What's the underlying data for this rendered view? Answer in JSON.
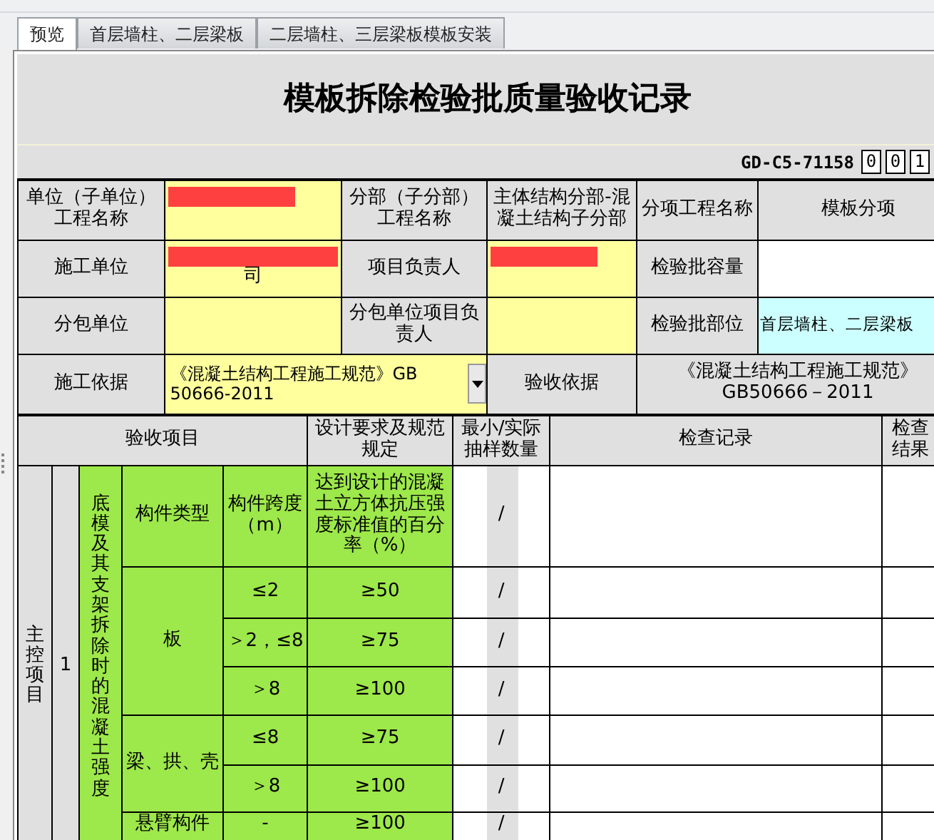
{
  "tabs": [
    {
      "label": "预览",
      "selected": true
    },
    {
      "label": "首层墙柱、二层梁板",
      "selected": false
    },
    {
      "label": "二层墙柱、三层梁板模板安装",
      "selected": false
    }
  ],
  "title": "模板拆除检验批质量验收记录",
  "form_code": "GD-C5-71158",
  "serial_digits": [
    "0",
    "0",
    "1"
  ],
  "info_rows": [
    [
      {
        "kind": "label",
        "text": "单位（子单位）工程名称"
      },
      {
        "kind": "input",
        "redacted": true
      },
      {
        "kind": "label",
        "text": "分部（子分部）工程名称"
      },
      {
        "kind": "label",
        "text": "主体结构分部-混凝土结构子分部"
      },
      {
        "kind": "label",
        "text": "分项工程名称"
      },
      {
        "kind": "label",
        "text": "模板分项"
      }
    ],
    [
      {
        "kind": "label",
        "text": "施工单位"
      },
      {
        "kind": "input",
        "redacted": true,
        "text": "司"
      },
      {
        "kind": "label",
        "text": "项目负责人"
      },
      {
        "kind": "input",
        "redacted": true
      },
      {
        "kind": "label",
        "text": "检验批容量"
      },
      {
        "kind": "field"
      }
    ],
    [
      {
        "kind": "label",
        "text": "分包单位"
      },
      {
        "kind": "input"
      },
      {
        "kind": "label",
        "text": "分包单位项目负责人"
      },
      {
        "kind": "input"
      },
      {
        "kind": "label",
        "text": "检验批部位"
      },
      {
        "kind": "highlight",
        "text": "首层墙柱、二层梁板"
      }
    ],
    [
      {
        "kind": "label",
        "text": "施工依据"
      },
      {
        "kind": "dropdown",
        "text": "《混凝土结构工程施工规范》GB 50666-2011"
      },
      {
        "kind": "label",
        "text": "验收依据"
      },
      {
        "kind": "label",
        "text": "《混凝土结构工程施工规范》GB50666－2011"
      }
    ]
  ],
  "checklist": {
    "headers": [
      "验收项目",
      "设计要求及规范规定",
      "最小/实际抽样数量",
      "检查记录",
      "检查结果"
    ],
    "category": "主控项目",
    "item_no": "1",
    "item_name": "底模及其支架拆除时的混凝土强度",
    "column_titles": [
      "构件类型",
      "构件跨度（m）",
      "达到设计的混凝土立方体抗压强度标准值的百分率（%）",
      "/"
    ],
    "groups": [
      {
        "type": "板",
        "rows": [
          {
            "span": "≤2",
            "requirement": "≥50",
            "sampling": "/"
          },
          {
            "span": "＞2，≤8",
            "requirement": "≥75",
            "sampling": "/"
          },
          {
            "span": "＞8",
            "requirement": "≥100",
            "sampling": "/"
          }
        ]
      },
      {
        "type": "梁、拱、壳",
        "rows": [
          {
            "span": "≤8",
            "requirement": "≥75",
            "sampling": "/"
          },
          {
            "span": "＞8",
            "requirement": "≥100",
            "sampling": "/"
          }
        ]
      },
      {
        "type": "悬臂构件",
        "rows": [
          {
            "span": "-",
            "requirement": "≥100",
            "sampling": "/"
          }
        ]
      }
    ]
  }
}
